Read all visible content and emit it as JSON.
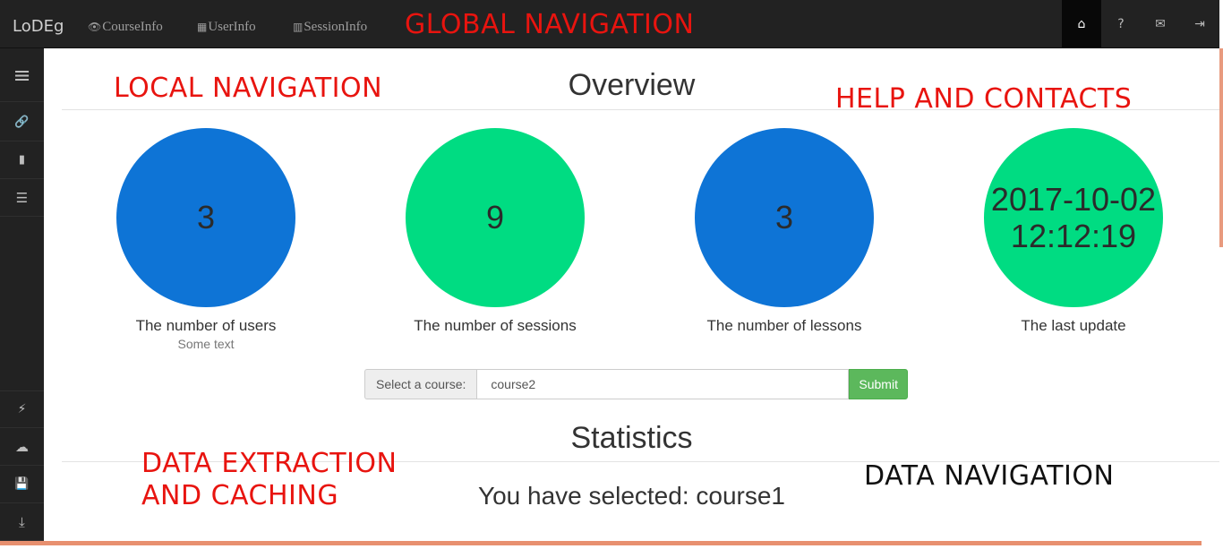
{
  "topbar": {
    "brand": "LoDEg",
    "nav": [
      {
        "icon": "eye-icon",
        "glyph": "👁",
        "label": "CourseInfo"
      },
      {
        "icon": "qrcode-icon",
        "glyph": "▦",
        "label": "UserInfo"
      },
      {
        "icon": "barcode-icon",
        "glyph": "▥",
        "label": "SessionInfo"
      }
    ],
    "right_icons": [
      {
        "icon": "home-icon",
        "glyph": "⌂"
      },
      {
        "icon": "question-icon",
        "glyph": "?"
      },
      {
        "icon": "envelope-icon",
        "glyph": "✉"
      },
      {
        "icon": "logout-icon",
        "glyph": "⇥"
      }
    ]
  },
  "sidebar": {
    "items": [
      {
        "icon": "menu-icon",
        "glyph": "≡"
      },
      {
        "icon": "link-icon",
        "glyph": "🔗"
      },
      {
        "icon": "bar-chart-icon",
        "glyph": "▮"
      },
      {
        "icon": "list-icon",
        "glyph": "☰"
      },
      {
        "icon": "flash-icon",
        "glyph": "⚡"
      },
      {
        "icon": "cloud-upload-icon",
        "glyph": "☁"
      },
      {
        "icon": "save-icon",
        "glyph": "💾"
      },
      {
        "icon": "download-icon",
        "glyph": "⤓"
      }
    ]
  },
  "annotations": {
    "global_navigation": "GLOBAL NAVIGATION",
    "local_navigation": "LOCAL NAVIGATION",
    "help_and_contacts": "HELP AND CONTACTS",
    "data_extraction_line1": "DATA EXTRACTION",
    "data_extraction_line2": "AND CACHING",
    "data_navigation": "DATA NAVIGATION"
  },
  "overview": {
    "title": "Overview",
    "stats": [
      {
        "value": "3",
        "label": "The number of users",
        "sublabel": "Some text",
        "color": "#0e74d6"
      },
      {
        "value": "9",
        "label": "The number of sessions",
        "sublabel": "",
        "color": "#00dc82"
      },
      {
        "value": "3",
        "label": "The number of lessons",
        "sublabel": "",
        "color": "#0e74d6"
      },
      {
        "value_line1": "2017-10-02",
        "value_line2": "12:12:19",
        "label": "The last update",
        "sublabel": "",
        "color": "#00dc82"
      }
    ]
  },
  "course_form": {
    "addon_label": "Select a course:",
    "selected_value": "course2",
    "submit_label": "Submit"
  },
  "statistics": {
    "title": "Statistics",
    "selected_text": "You have selected: course1"
  },
  "colors": {
    "navbar": "#222222",
    "blue": "#0e74d6",
    "green": "#00dc82",
    "annotation_red": "#e8140f",
    "submit_green": "#5cb85c"
  }
}
